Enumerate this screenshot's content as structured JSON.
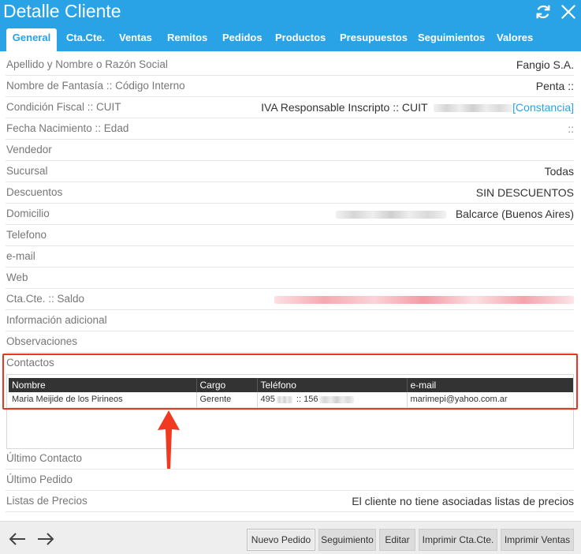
{
  "window": {
    "title": "Detalle Cliente"
  },
  "tabs": [
    {
      "label": "General"
    },
    {
      "label": "Cta.Cte."
    },
    {
      "label": "Ventas"
    },
    {
      "label": "Remitos"
    },
    {
      "label": "Pedidos"
    },
    {
      "label": "Productos"
    },
    {
      "label": "Presupuestos"
    },
    {
      "label": "Seguimientos"
    },
    {
      "label": "Valores"
    }
  ],
  "fields": {
    "razon_social": {
      "label": "Apellido y Nombre o Razón Social",
      "value": "Fangio S.A."
    },
    "fantasia": {
      "label": "Nombre de Fantasía :: Código Interno",
      "value": "Penta ::"
    },
    "fiscal": {
      "label": "Condición Fiscal :: CUIT",
      "value": "IVA Responsable Inscripto :: CUIT",
      "link": "[Constancia]"
    },
    "nacimiento": {
      "label": "Fecha Nacimiento :: Edad",
      "value": "::"
    },
    "vendedor": {
      "label": "Vendedor",
      "value": ""
    },
    "sucursal": {
      "label": "Sucursal",
      "value": "Todas"
    },
    "descuentos": {
      "label": "Descuentos",
      "value": "SIN DESCUENTOS"
    },
    "domicilio": {
      "label": "Domicilio",
      "value": "Balcarce (Buenos Aires)"
    },
    "telefono": {
      "label": "Telefono",
      "value": ""
    },
    "email": {
      "label": "e-mail",
      "value": ""
    },
    "web": {
      "label": "Web",
      "value": ""
    },
    "ctacte": {
      "label": "Cta.Cte. :: Saldo",
      "value": ""
    },
    "info_adicional": {
      "label": "Información adicional",
      "value": ""
    },
    "observaciones": {
      "label": "Observaciones",
      "value": ""
    },
    "contactos": {
      "label": "Contactos"
    },
    "ultimo_contacto": {
      "label": "Último Contacto",
      "value": ""
    },
    "ultimo_pedido": {
      "label": "Último Pedido",
      "value": ""
    },
    "listas_precios": {
      "label": "Listas de Precios",
      "value": "El cliente no tiene asociadas listas de precios"
    }
  },
  "contacts": {
    "columns": [
      "Nombre",
      "Cargo",
      "Teléfono",
      "e-mail"
    ],
    "rows": [
      {
        "nombre": "Maria Meijide de los Pirineos",
        "cargo": "Gerente",
        "telefono_a": "495",
        "telefono_sep": ":: 156",
        "email": "marimepi@yahoo.com.ar"
      }
    ]
  },
  "buttons": {
    "nuevo_pedido": "Nuevo Pedido",
    "seguimiento": "Seguimiento",
    "editar": "Editar",
    "imprimir_ctacte": "Imprimir Cta.Cte.",
    "imprimir_ventas": "Imprimir Ventas"
  },
  "colors": {
    "accent": "#29a3e6",
    "highlight": "#ee3224",
    "table_header": "#333333"
  }
}
